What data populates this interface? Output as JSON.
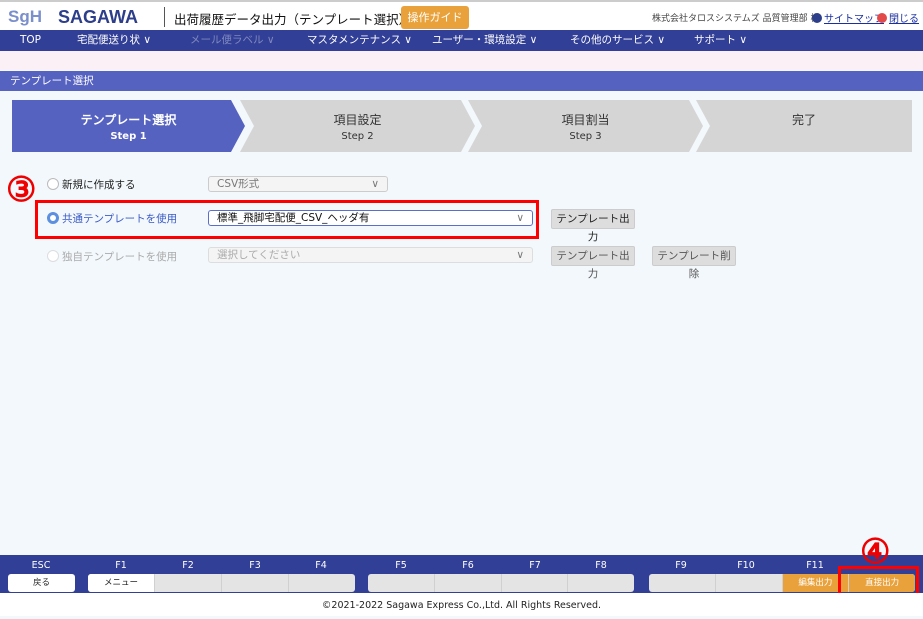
{
  "header": {
    "logo_mark": "SgH",
    "logo": "SAGAWA",
    "title": "出荷履歴データ出力（テンプレート選択）",
    "guide_button": "操作ガイド",
    "company": "株式会社タロスシステムズ 品質管理部 様",
    "sitemap": "サイトマップ",
    "close": "閉じる"
  },
  "nav": [
    {
      "label": "TOP"
    },
    {
      "label": "宅配便送り状 ∨"
    },
    {
      "label": "メール便ラベル ∨",
      "disabled": true
    },
    {
      "label": "マスタメンテナンス ∨"
    },
    {
      "label": "ユーザー・環境設定 ∨"
    },
    {
      "label": "その他のサービス ∨"
    },
    {
      "label": "サポート ∨"
    }
  ],
  "section_title": "テンプレート選択",
  "steps": [
    {
      "title": "テンプレート選択",
      "sub": "Step 1",
      "active": true
    },
    {
      "title": "項目設定",
      "sub": "Step 2"
    },
    {
      "title": "項目割当",
      "sub": "Step 3"
    },
    {
      "title": "完了",
      "sub": ""
    }
  ],
  "options": {
    "new": {
      "label": "新規に作成する",
      "select": "CSV形式"
    },
    "common": {
      "label": "共通テンプレートを使用",
      "select": "標準_飛脚宅配便_CSV_ヘッダ有",
      "button": "テンプレート出力",
      "selected": true
    },
    "own": {
      "label": "独自テンプレートを使用",
      "select": "選択してください",
      "button": "テンプレート出力",
      "delete_button": "テンプレート削除",
      "disabled": true
    }
  },
  "annotations": {
    "step3": "③",
    "step4": "④"
  },
  "fkeys": {
    "labels": [
      "ESC",
      "F1",
      "F2",
      "F3",
      "F4",
      "F5",
      "F6",
      "F7",
      "F8",
      "F9",
      "F10",
      "F11"
    ],
    "esc": "戻る",
    "f1": "メニュー",
    "f11": "編集出力",
    "f12": "直接出力"
  },
  "footer": "©2021-2022 Sagawa Express Co.,Ltd. All Rights Reserved.",
  "colors": {
    "nav": "#323f96",
    "accent": "#5662c0",
    "orange": "#e9a23b",
    "annotation": "#ff0000"
  }
}
